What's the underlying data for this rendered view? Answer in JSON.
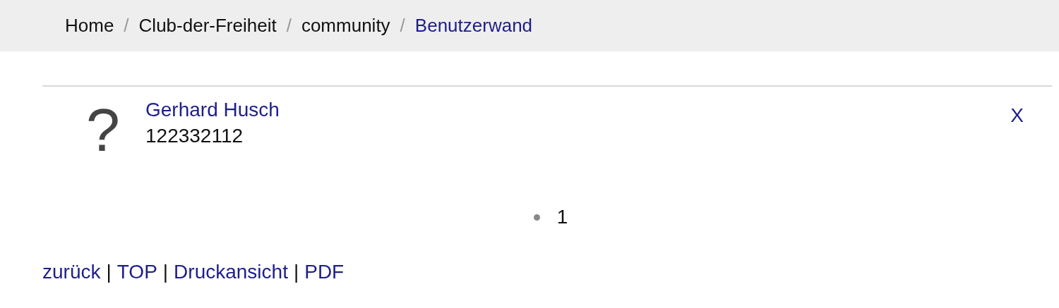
{
  "breadcrumb": [
    {
      "label": "Home",
      "current": false
    },
    {
      "label": "Club-der-Freiheit",
      "current": false
    },
    {
      "label": "community",
      "current": false
    },
    {
      "label": "Benutzerwand",
      "current": true
    }
  ],
  "breadcrumb_separator": "/",
  "entries": [
    {
      "avatar": "?",
      "name": "Gerhard Husch",
      "number": "122332112",
      "close": "X"
    }
  ],
  "pagination": [
    {
      "label": "1",
      "selected": true
    }
  ],
  "footer_links": [
    "zurück",
    "TOP",
    "Druckansicht",
    "PDF"
  ],
  "footer_separator": "|"
}
